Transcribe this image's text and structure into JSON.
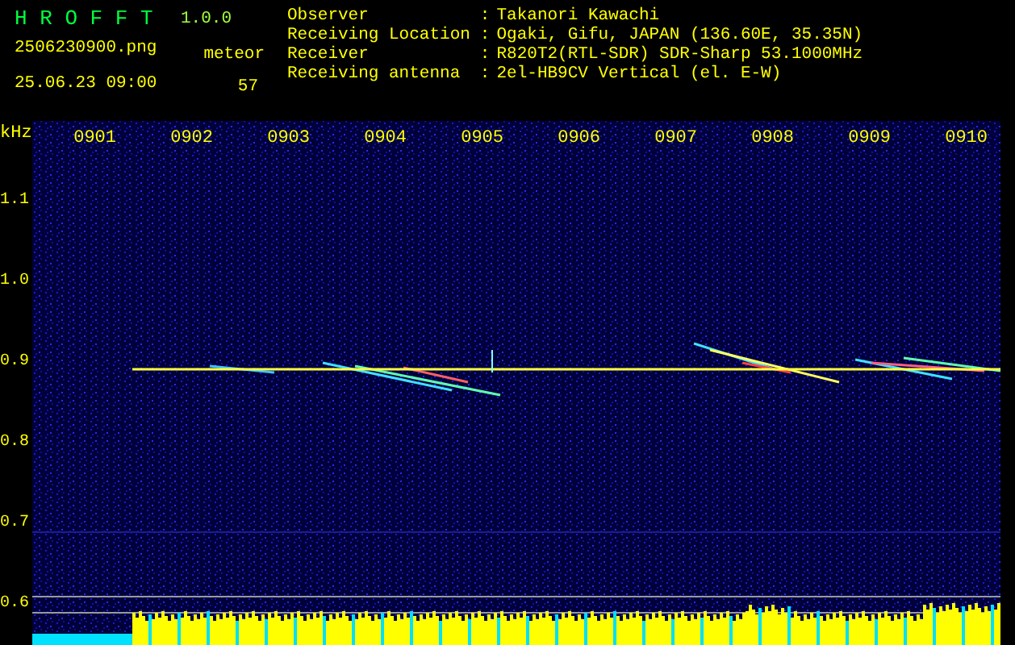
{
  "header": {
    "app_name": "H R O F F T",
    "version": "1.0.0",
    "filename": "2506230900.png",
    "datetime": "25.06.23 09:00",
    "count_label": "meteor",
    "count": "57",
    "info": [
      {
        "label": "Observer",
        "separator": ":",
        "value": "Takanori Kawachi"
      },
      {
        "label": "Receiving Location",
        "separator": ":",
        "value": "Ogaki, Gifu, JAPAN (136.60E, 35.35N)"
      },
      {
        "label": "Receiver",
        "separator": ":",
        "value": "R820T2(RTL-SDR) SDR-Sharp 53.1000MHz"
      },
      {
        "label": "Receiving antenna",
        "separator": ":",
        "value": "2el-HB9CV Vertical (el. E-W)"
      }
    ]
  },
  "spectrogram": {
    "unit": "kHz",
    "y_labels": [
      "1.1",
      "1.0",
      "0.9",
      "0.8",
      "0.7",
      "0.6"
    ],
    "x_labels": [
      "0901",
      "0902",
      "0903",
      "0904",
      "0905",
      "0906",
      "0907",
      "0908",
      "0909",
      "0910"
    ]
  }
}
